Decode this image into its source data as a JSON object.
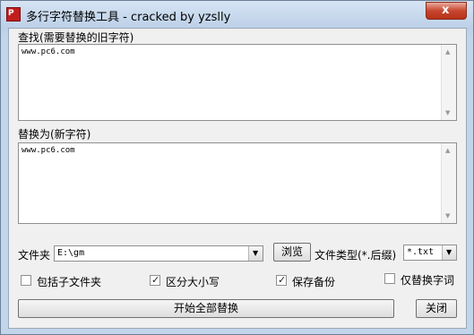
{
  "window": {
    "title": "多行字符替换工具 - cracked by yzslly",
    "close_glyph": "x",
    "app_icon_text": "P"
  },
  "find": {
    "label": "查找(需要替换的旧字符)",
    "value": "www.pc6.com"
  },
  "replace": {
    "label": "替换为(新字符)",
    "value": "www.pc6.com"
  },
  "folder": {
    "label": "文件夹",
    "value": "E:\\gm",
    "browse_label": "浏览"
  },
  "filetype": {
    "label": "文件类型(*.后缀)",
    "value": "*.txt"
  },
  "options": [
    {
      "label": "包括子文件夹",
      "checked": false
    },
    {
      "label": "区分大小写",
      "checked": true
    },
    {
      "label": "保存备份",
      "checked": true
    },
    {
      "label": "仅替换字词",
      "checked": false
    }
  ],
  "actions": {
    "replace_all_label": "开始全部替换",
    "close_label": "关闭"
  },
  "icons": {
    "scroll_up": "▲",
    "scroll_down": "▼",
    "dropdown": "▼",
    "check": "✓"
  },
  "colors": {
    "title_bar": "#c9dcf1",
    "close_button": "#c7462f",
    "dialog_bg": "#f0f0f0"
  }
}
